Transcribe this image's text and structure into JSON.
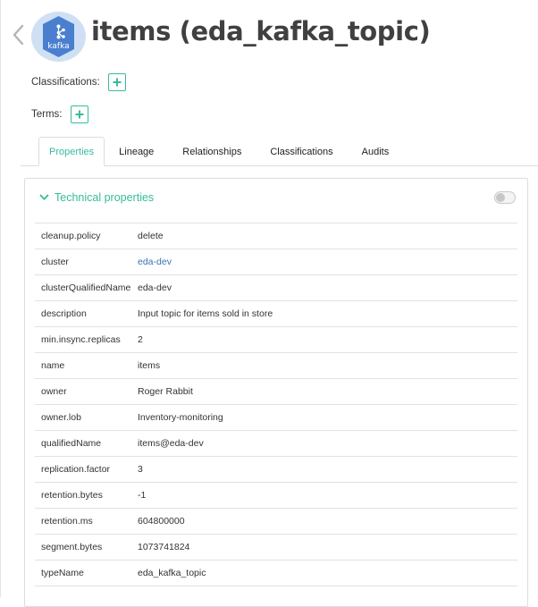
{
  "header": {
    "title": "items (eda_kafka_topic)",
    "logo_text": "kafka"
  },
  "meta": {
    "classifications_label": "Classifications:",
    "terms_label": "Terms:"
  },
  "tabs": [
    {
      "label": "Properties",
      "active": true
    },
    {
      "label": "Lineage",
      "active": false
    },
    {
      "label": "Relationships",
      "active": false
    },
    {
      "label": "Classifications",
      "active": false
    },
    {
      "label": "Audits",
      "active": false
    }
  ],
  "panel": {
    "title": "Technical properties",
    "toggle_on": false,
    "properties": [
      {
        "key": "cleanup.policy",
        "value": "delete"
      },
      {
        "key": "cluster",
        "value": "eda-dev",
        "link": true
      },
      {
        "key": "clusterQualifiedName",
        "value": "eda-dev"
      },
      {
        "key": "description",
        "value": "Input topic for items sold in store"
      },
      {
        "key": "min.insync.replicas",
        "value": "2"
      },
      {
        "key": "name",
        "value": "items"
      },
      {
        "key": "owner",
        "value": "Roger Rabbit"
      },
      {
        "key": "owner.lob",
        "value": "Inventory-monitoring"
      },
      {
        "key": "qualifiedName",
        "value": "items@eda-dev"
      },
      {
        "key": "replication.factor",
        "value": "3"
      },
      {
        "key": "retention.bytes",
        "value": "-1"
      },
      {
        "key": "retention.ms",
        "value": "604800000"
      },
      {
        "key": "segment.bytes",
        "value": "1073741824"
      },
      {
        "key": "typeName",
        "value": "eda_kafka_topic"
      }
    ]
  },
  "colors": {
    "accent": "#38bb9b",
    "link": "#3d71b3",
    "logo_hex": "#4a7fd0"
  }
}
